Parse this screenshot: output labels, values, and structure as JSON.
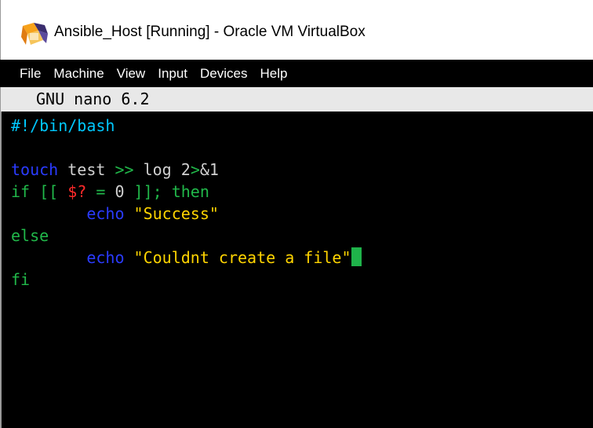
{
  "window": {
    "title": "Ansible_Host [Running] - Oracle VM VirtualBox",
    "icon": "virtualbox-icon"
  },
  "menu": [
    "File",
    "Machine",
    "View",
    "Input",
    "Devices",
    "Help"
  ],
  "editor": {
    "header": "GNU nano 6.2",
    "colors": {
      "comment": "#00c8ff",
      "keyword": "#2a3bff",
      "control": "#21b84a",
      "string": "#ffd400",
      "variable": "#ff2a2a",
      "text": "#d0d0d0",
      "cursor": "#1fb34a"
    },
    "lines": [
      [
        {
          "t": "#!/bin/bash",
          "c": "comment"
        }
      ],
      [],
      [
        {
          "t": "touch",
          "c": "keyword"
        },
        {
          "t": " test ",
          "c": "text"
        },
        {
          "t": ">>",
          "c": "control"
        },
        {
          "t": " log 2",
          "c": "text"
        },
        {
          "t": ">",
          "c": "control"
        },
        {
          "t": "&1",
          "c": "text"
        }
      ],
      [
        {
          "t": "if [[ ",
          "c": "control"
        },
        {
          "t": "$?",
          "c": "variable"
        },
        {
          "t": " = ",
          "c": "control"
        },
        {
          "t": "0",
          "c": "text"
        },
        {
          "t": " ]]; then",
          "c": "control"
        }
      ],
      [
        {
          "t": "        ",
          "c": "text"
        },
        {
          "t": "echo",
          "c": "keyword"
        },
        {
          "t": " ",
          "c": "text"
        },
        {
          "t": "\"Success\"",
          "c": "string"
        }
      ],
      [
        {
          "t": "else",
          "c": "control"
        }
      ],
      [
        {
          "t": "        ",
          "c": "text"
        },
        {
          "t": "echo",
          "c": "keyword"
        },
        {
          "t": " ",
          "c": "text"
        },
        {
          "t": "\"Couldnt create a file\"",
          "c": "string"
        },
        {
          "cursor": true
        }
      ],
      [
        {
          "t": "fi",
          "c": "control"
        }
      ]
    ]
  }
}
